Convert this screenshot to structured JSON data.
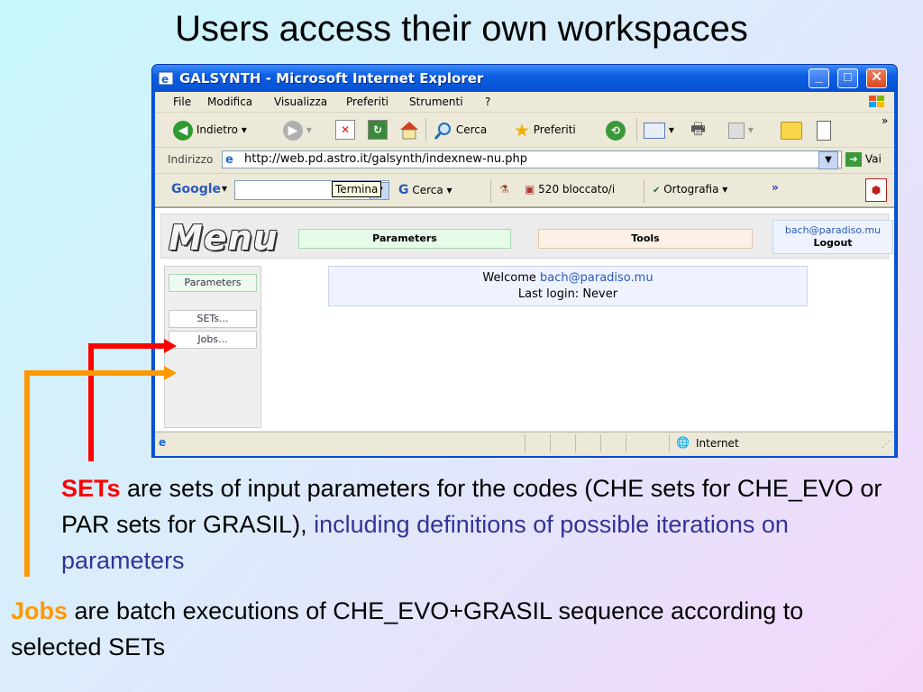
{
  "slide": {
    "title": "Users access their own workspaces"
  },
  "browser": {
    "window_title": "GALSYNTH - Microsoft Internet Explorer",
    "menubar": [
      "File",
      "Modifica",
      "Visualizza",
      "Preferiti",
      "Strumenti",
      "?"
    ],
    "toolbar": {
      "back_label": "Indietro",
      "search_label": "Cerca",
      "favorites_label": "Preferiti"
    },
    "address": {
      "label": "Indirizzo",
      "url": "http://web.pd.astro.it/galsynth/indexnew-nu.php",
      "go_label": "Vai"
    },
    "tooltip": "Termina",
    "google": {
      "logo": "Google",
      "search_label": "Cerca",
      "blocked_label": "520 bloccato/i",
      "spell_label": "Ortografia"
    },
    "status": {
      "zone": "Internet"
    }
  },
  "webpage": {
    "logo": "Menu",
    "nav": {
      "parameters": "Parameters",
      "tools": "Tools"
    },
    "user": {
      "email": "bach@paradiso.mu",
      "logout": "Logout"
    },
    "sidebar": {
      "header": "Parameters",
      "sets": "SETs...",
      "jobs": "Jobs..."
    },
    "welcome": {
      "prefix": "Welcome",
      "user": "bach@paradiso.mu",
      "last_login": "Last login: Never"
    }
  },
  "notes": {
    "sets_term": "SETs",
    "sets_text": " are sets of input parameters for the codes (CHE sets for CHE_EVO or PAR sets for GRASIL), ",
    "sets_highlight": "including definitions of possible iterations on parameters",
    "jobs_term": "Jobs",
    "jobs_text": " are batch executions of CHE_EVO+GRASIL sequence according to selected SETs"
  },
  "colors": {
    "sets_arrow": "#ff0000",
    "jobs_arrow": "#ff9900",
    "highlight_text": "#333399",
    "xp_title": "#0a56d8"
  }
}
